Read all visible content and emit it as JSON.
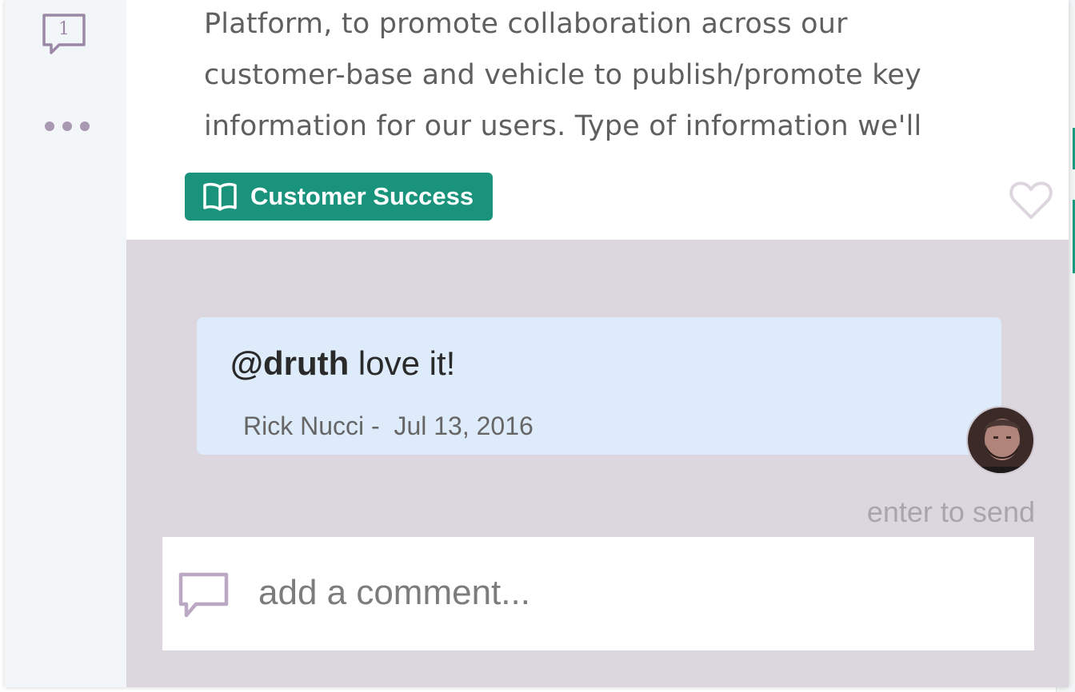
{
  "post": {
    "text_lines": [
      "Platform, to promote collaboration across our",
      "customer-base and vehicle to publish/promote key",
      "information for our users.  Type of information we'll"
    ],
    "comment_count": "1",
    "tag_label": "Customer Success"
  },
  "comment": {
    "mention": "@druth",
    "text": " love it!",
    "author": "Rick Nucci",
    "separator": " -  ",
    "date": "Jul 13, 2016"
  },
  "composer": {
    "hint": "enter to send",
    "placeholder": "add a comment..."
  },
  "colors": {
    "tag_bg": "#1a937d",
    "comment_area_bg": "#dcd6de",
    "bubble_bg": "#deebfb",
    "icon_purple": "#a998b2"
  },
  "icons": [
    "comment-count-icon",
    "more-options-icon",
    "book-icon",
    "heart-icon",
    "avatar",
    "chat-bubble-icon"
  ]
}
